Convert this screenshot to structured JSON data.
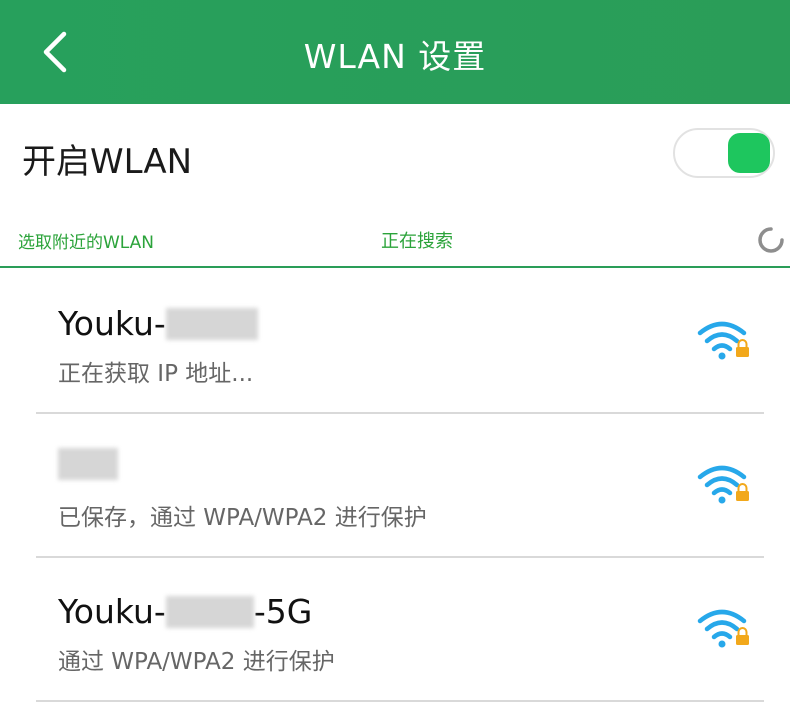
{
  "header": {
    "title": "WLAN 设置",
    "background": "#2a9d58"
  },
  "toggle": {
    "label": "开启WLAN",
    "on": true,
    "on_color": "#1ec65e"
  },
  "section": {
    "left_label": "选取附近的WLAN",
    "center_label": "正在搜索",
    "accent_color": "#2ba33a"
  },
  "networks": [
    {
      "name_prefix": "Youku-",
      "name_suffix": "",
      "status": "正在获取 IP 地址...",
      "icon": "wifi-locked-icon"
    },
    {
      "name_prefix": "",
      "name_suffix": "",
      "status": "已保存，通过 WPA/WPA2 进行保护",
      "icon": "wifi-locked-icon"
    },
    {
      "name_prefix": "Youku-",
      "name_suffix": "-5G",
      "status": "通过 WPA/WPA2 进行保护",
      "icon": "wifi-locked-icon"
    }
  ],
  "colors": {
    "wifi_blue": "#27a8ea",
    "lock_orange": "#f2a81b",
    "divider": "#d9d9d9"
  }
}
